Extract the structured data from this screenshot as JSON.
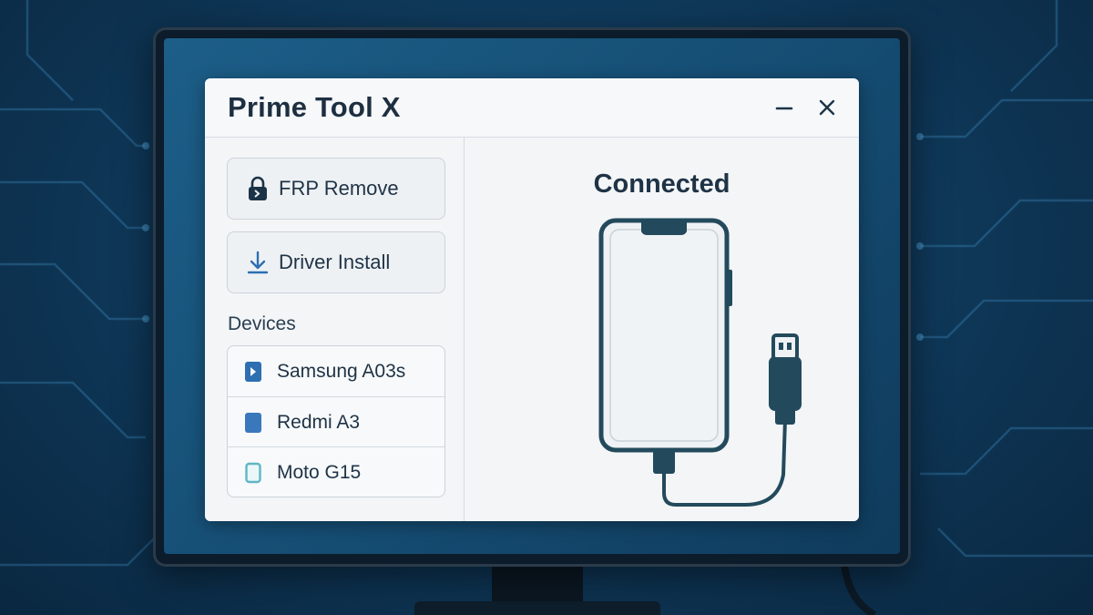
{
  "window": {
    "title": "Prime Tool X",
    "minimize_glyph": "–",
    "close_glyph": "×"
  },
  "sidebar": {
    "actions": [
      {
        "label": "FRP Remove",
        "icon": "lock-icon"
      },
      {
        "label": "Driver Install",
        "icon": "download-icon"
      }
    ],
    "devices_heading": "Devices",
    "devices": [
      {
        "label": "Samsung A03s",
        "icon": "play-device-icon"
      },
      {
        "label": "Redmi A3",
        "icon": "phone-filled-icon"
      },
      {
        "label": "Moto G15",
        "icon": "phone-outline-icon"
      }
    ]
  },
  "main": {
    "status": "Connected",
    "illustration": "phone-usb-cable-icon"
  },
  "colors": {
    "accent": "#2e6fb2",
    "dark_navy": "#1b3347",
    "teal_illustration": "#234a5c",
    "background_blue": "#154c72"
  }
}
